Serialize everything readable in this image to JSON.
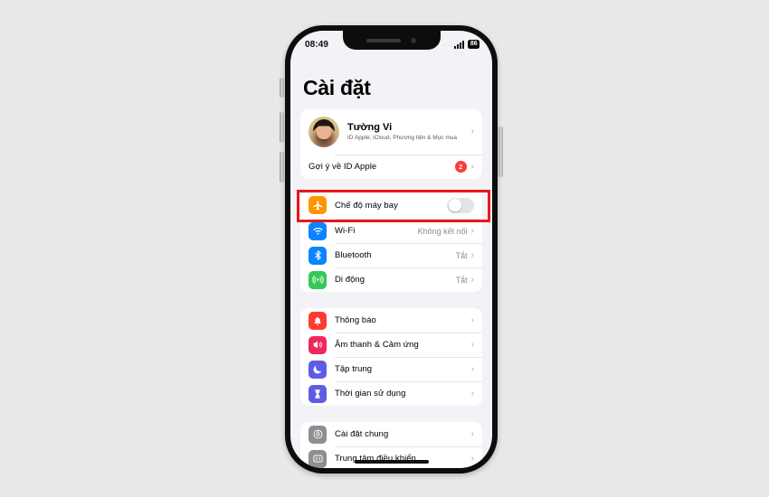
{
  "device": {
    "status_bar": {
      "time": "08:49",
      "battery_level": "86",
      "signal_icon": "cellular-signal-icon",
      "battery_icon": "battery-icon"
    }
  },
  "settings": {
    "page_title": "Cài đặt",
    "account": {
      "name": "Tường Vi",
      "subtitle": "ID Apple, iCloud, Phương tiện & Mục mua",
      "avatar_name": "user-avatar"
    },
    "apple_id_suggestion": {
      "label": "Gợi ý về ID Apple",
      "badge": "2"
    },
    "connectivity_group": [
      {
        "label": "Chế độ máy bay",
        "icon": "airplane-icon",
        "icon_color": "#ff9500",
        "control": "toggle",
        "toggle_on": false,
        "highlighted": true
      },
      {
        "label": "Wi-Fi",
        "icon": "wifi-icon",
        "icon_color": "#0a84ff",
        "value": "Không kết nối"
      },
      {
        "label": "Bluetooth",
        "icon": "bluetooth-icon",
        "icon_color": "#0a84ff",
        "value": "Tắt"
      },
      {
        "label": "Di động",
        "icon": "cellular-icon",
        "icon_color": "#34c759",
        "value": "Tắt"
      }
    ],
    "notifications_group": [
      {
        "label": "Thông báo",
        "icon": "bell-icon",
        "icon_color": "#ff3b30"
      },
      {
        "label": "Âm thanh & Cảm ứng",
        "icon": "speaker-icon",
        "icon_color": "#f0285a"
      },
      {
        "label": "Tập trung",
        "icon": "moon-icon",
        "icon_color": "#5e5ce6"
      },
      {
        "label": "Thời gian sử dụng",
        "icon": "hourglass-icon",
        "icon_color": "#5e5ce6"
      }
    ],
    "general_group": [
      {
        "label": "Cài đặt chung",
        "icon": "gear-icon",
        "icon_color": "#8e8e93"
      },
      {
        "label": "Trung tâm điều khiển",
        "icon": "control-center-icon",
        "icon_color": "#8e8e93"
      }
    ],
    "chevron_glyph": "›"
  },
  "annotation": {
    "highlight_color": "#e8191a",
    "target": "Chế độ máy bay"
  }
}
